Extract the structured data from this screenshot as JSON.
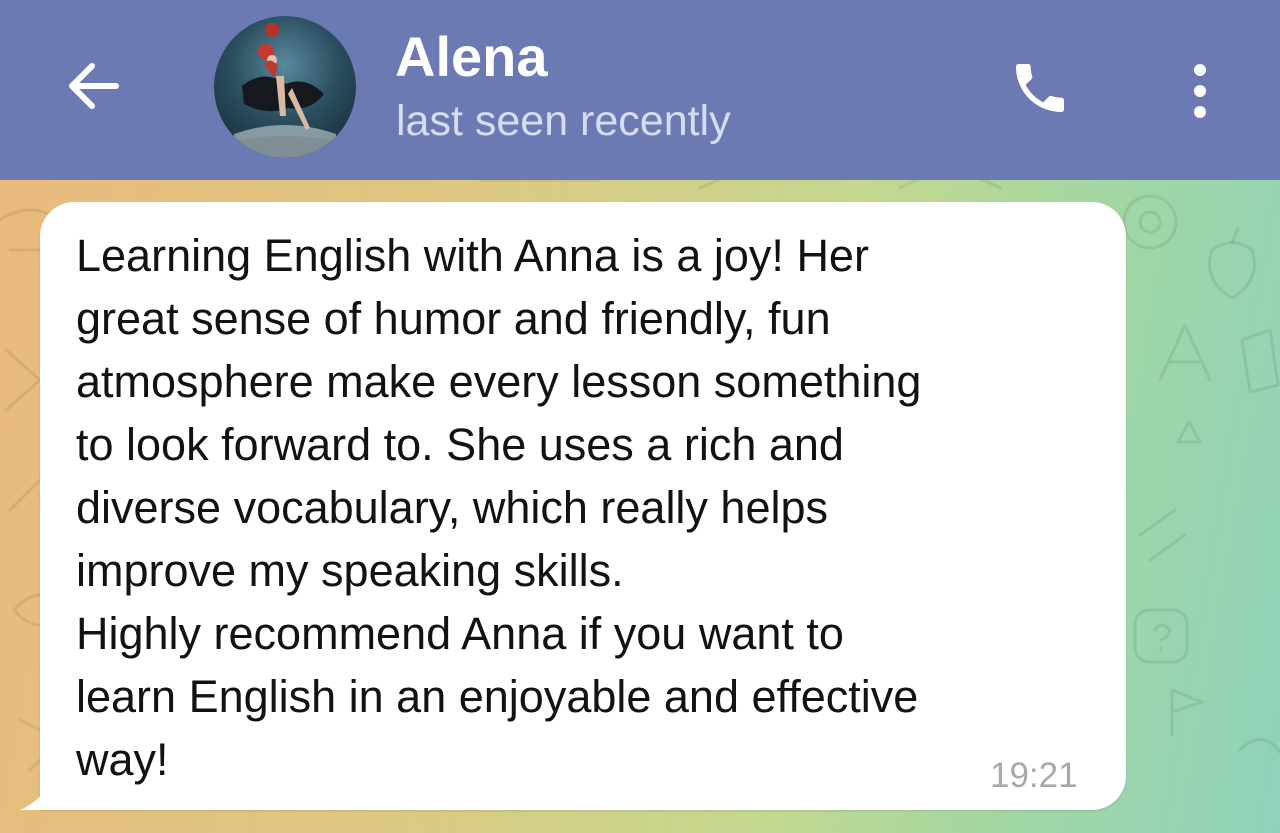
{
  "header": {
    "back_icon": "arrow-left-icon",
    "contact_name": "Alena",
    "status": "last seen recently",
    "call_icon": "phone-icon",
    "menu_icon": "more-vertical-icon",
    "background_color": "#6b7ab3"
  },
  "message": {
    "text": "Learning English with Anna is a joy! Her\ngreat sense of humor and friendly, fun\natmosphere make every lesson something\nto look forward to. She uses a rich and\ndiverse vocabulary, which really helps\nimprove my speaking skills.\nHighly recommend Anna if you want to\nlearn English in an enjoyable and effective\nway!",
    "time": "19:21"
  }
}
